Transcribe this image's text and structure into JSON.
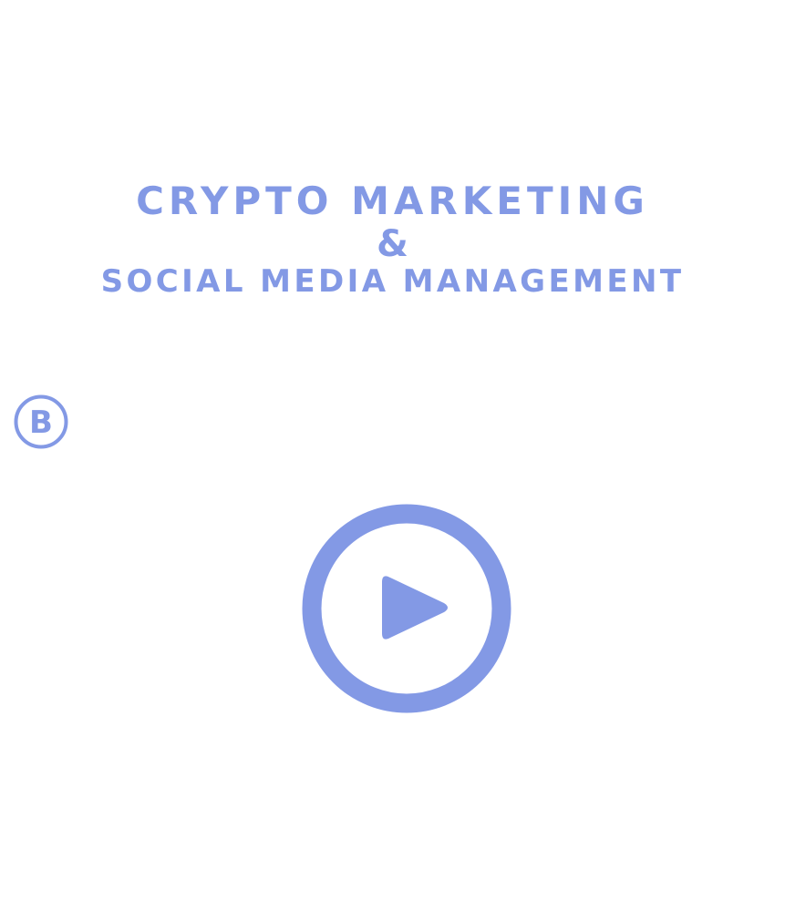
{
  "hero": {
    "title_line_1": "CRYPTO MARKETING",
    "title_ampersand": "&",
    "title_line_2": "SOCIAL MEDIA MANAGEMENT"
  },
  "brand": {
    "logo_letter": "B",
    "logo_icon": "brand-b-circle-icon"
  },
  "video": {
    "play_icon": "play-circle-icon"
  },
  "colors": {
    "accent": "#8399e5",
    "background": "#ffffff"
  }
}
